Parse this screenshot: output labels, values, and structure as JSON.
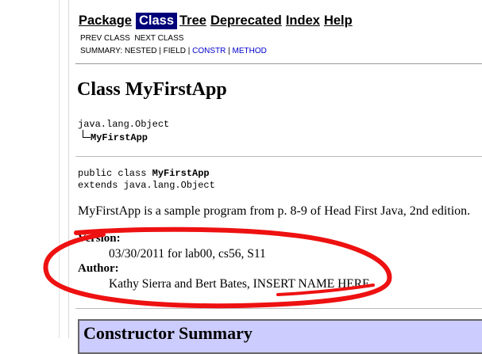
{
  "nav": {
    "items": [
      {
        "label": "Package",
        "active": false
      },
      {
        "label": "Class",
        "active": true
      },
      {
        "label": "Tree",
        "active": false
      },
      {
        "label": "Deprecated",
        "active": false
      },
      {
        "label": "Index",
        "active": false
      },
      {
        "label": "Help",
        "active": false
      }
    ],
    "prev_class": "PREV CLASS",
    "next_class": "NEXT CLASS",
    "summary_prefix": "SUMMARY: NESTED | FIELD | ",
    "summary_constr": "CONSTR",
    "summary_sep": " | ",
    "summary_method": "METHOD"
  },
  "class": {
    "title": "Class MyFirstApp",
    "hierarchy_root": "java.lang.Object",
    "hierarchy_child": "MyFirstApp",
    "decl_prefix": "public class ",
    "decl_name": "MyFirstApp",
    "decl_extends": "extends java.lang.Object",
    "description": "MyFirstApp is a sample program from p. 8-9 of Head First Java, 2nd edition."
  },
  "tags": {
    "version_label": "Version:",
    "version_value": "03/30/2011 for lab00, cs56, S11",
    "author_label": "Author:",
    "author_value": "Kathy Sierra and Bert Bates, INSERT NAME HERE"
  },
  "constructor_summary": {
    "title": "Constructor Summary"
  },
  "colors": {
    "nav_active_bg": "#00007a",
    "summary_bg": "#ccccff",
    "annotation": "#ee1111"
  }
}
